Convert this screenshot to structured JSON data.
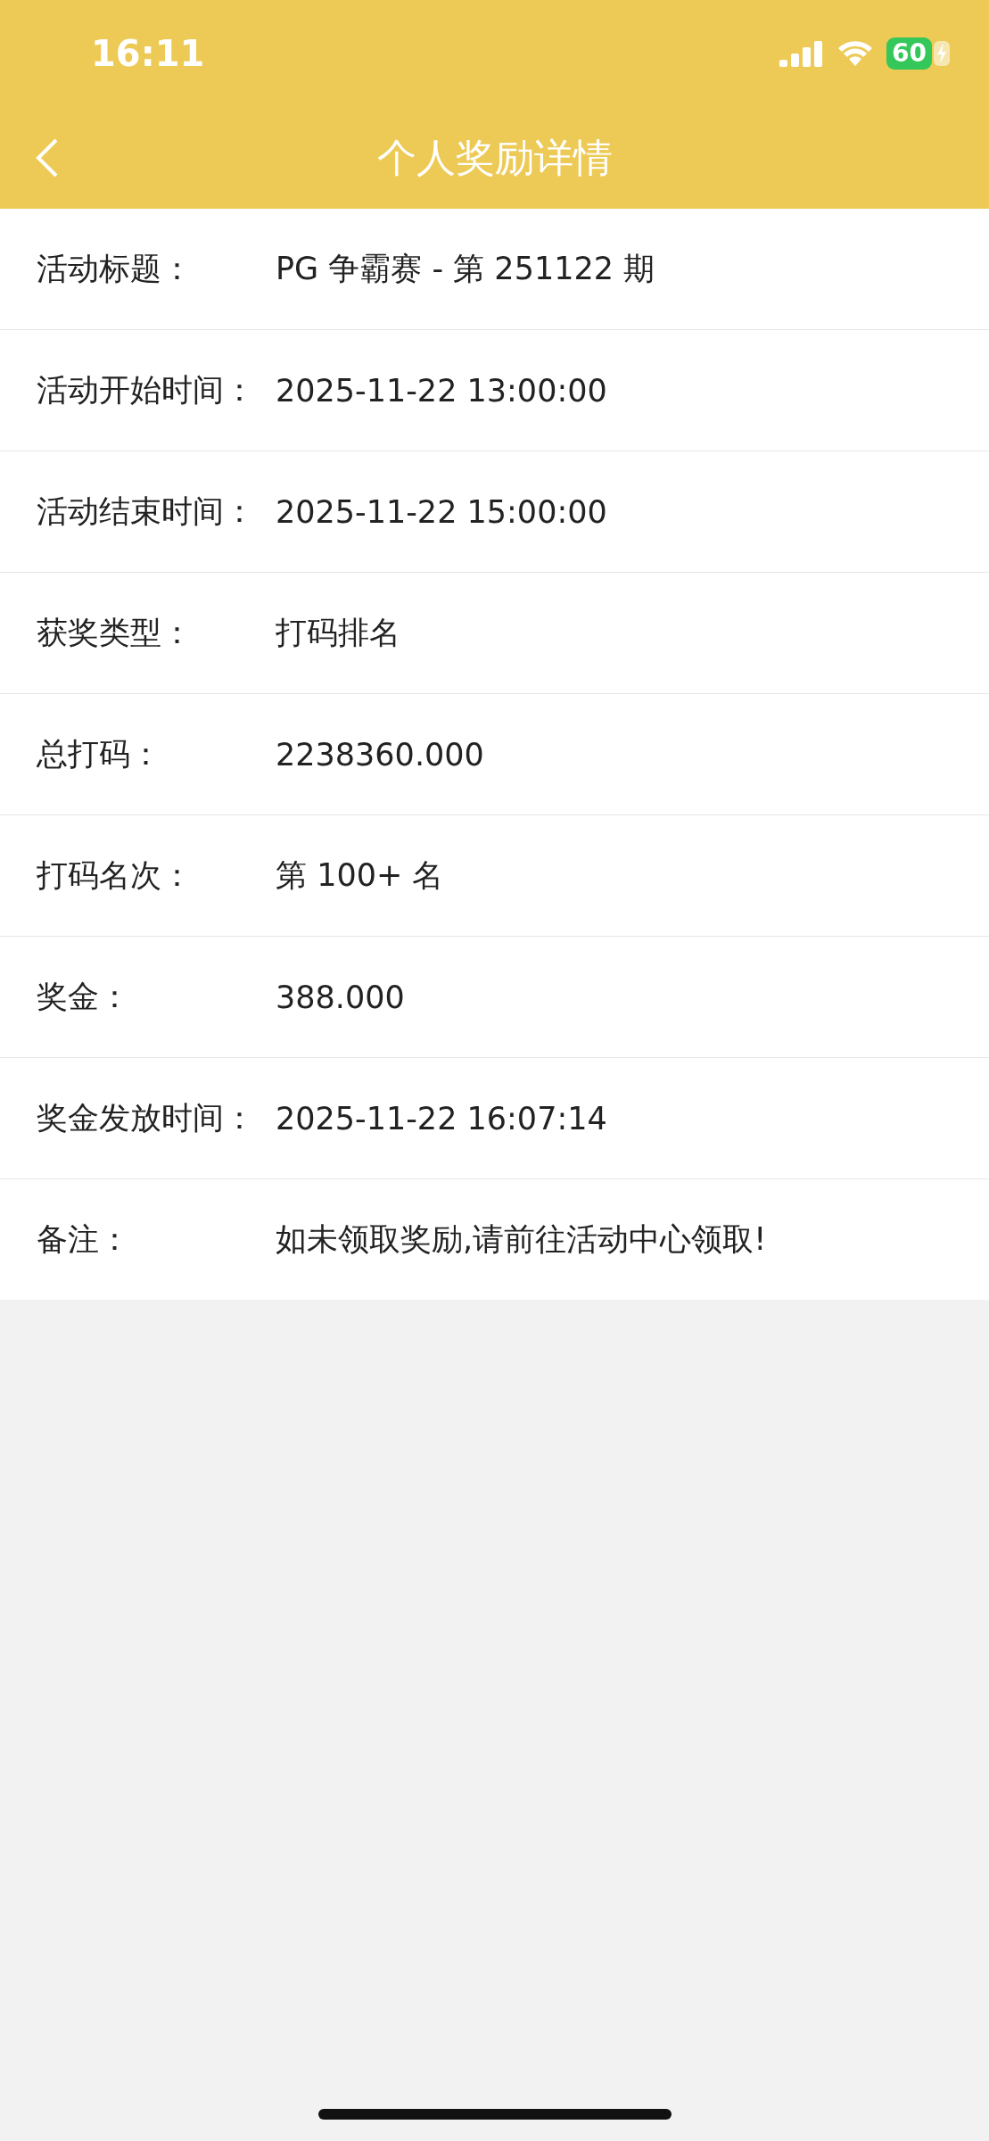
{
  "status_bar": {
    "time": "16:11",
    "battery": "60",
    "charging": true
  },
  "nav": {
    "title": "个人奖励详情"
  },
  "rows": [
    {
      "label": "活动标题：",
      "value": "PG 争霸赛 - 第 251122 期"
    },
    {
      "label": "活动开始时间：",
      "value": "2025-11-22 13:00:00"
    },
    {
      "label": "活动结束时间：",
      "value": "2025-11-22 15:00:00"
    },
    {
      "label": "获奖类型：",
      "value": "打码排名"
    },
    {
      "label": "总打码：",
      "value": "2238360.000"
    },
    {
      "label": "打码名次：",
      "value": "第 100+ 名"
    },
    {
      "label": "奖金：",
      "value": "388.000"
    },
    {
      "label": "奖金发放时间：",
      "value": "2025-11-22 16:07:14"
    },
    {
      "label": "备注：",
      "value": "如未领取奖励,请前往活动中心领取!"
    }
  ]
}
